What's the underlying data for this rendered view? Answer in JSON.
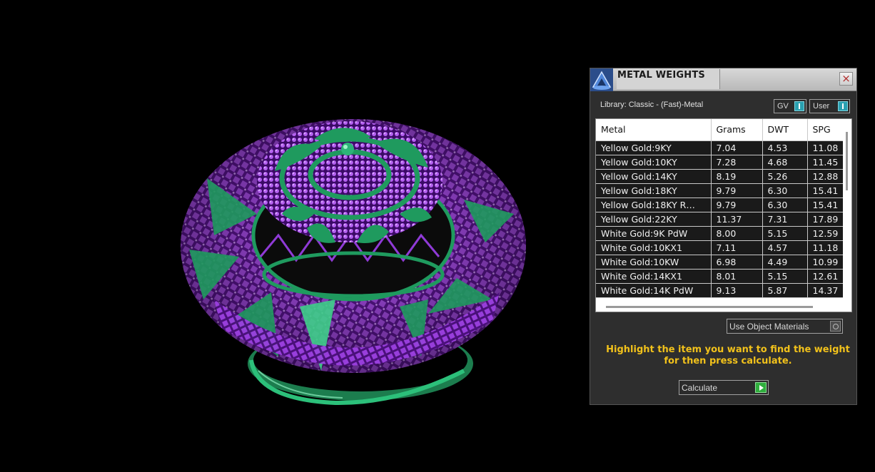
{
  "panel": {
    "title": "METAL WEIGHTS",
    "close_symbol": "×",
    "library_label": "Library: Classic - (Fast)-Metal",
    "gv_label": "GV",
    "user_label": "User",
    "use_object_materials_label": "Use Object Materials",
    "hint_line1": "Highlight the item you want to find the weight",
    "hint_line2": "for then press calculate.",
    "calculate_label": "Calculate"
  },
  "table": {
    "columns": [
      "Metal",
      "Grams",
      "DWT",
      "SPG"
    ],
    "rows": [
      [
        "Yellow Gold:9KY",
        "7.04",
        "4.53",
        "11.08"
      ],
      [
        "Yellow Gold:10KY",
        "7.28",
        "4.68",
        "11.45"
      ],
      [
        "Yellow Gold:14KY",
        "8.19",
        "5.26",
        "12.88"
      ],
      [
        "Yellow Gold:18KY",
        "9.79",
        "6.30",
        "15.41"
      ],
      [
        "Yellow Gold:18KY R…",
        "9.79",
        "6.30",
        "15.41"
      ],
      [
        "Yellow Gold:22KY",
        "11.37",
        "7.31",
        "17.89"
      ],
      [
        "White Gold:9K PdW",
        "8.00",
        "5.15",
        "12.59"
      ],
      [
        "White Gold:10KX1",
        "7.11",
        "4.57",
        "11.18"
      ],
      [
        "White Gold:10KW",
        "6.98",
        "4.49",
        "10.99"
      ],
      [
        "White Gold:14KX1",
        "8.01",
        "5.15",
        "12.61"
      ],
      [
        "White Gold:14K PdW",
        "9.13",
        "5.87",
        "14.37"
      ]
    ]
  },
  "colors": {
    "hint_text": "#f2c21b",
    "ring_purple": "#8a2bd0",
    "ring_green": "#1f9a5e"
  },
  "icons": {
    "app": "rhino-jewel-icon",
    "close": "close-icon",
    "gv_toggle": "toggle-icon",
    "user_toggle": "toggle-icon",
    "materials": "radio-icon",
    "calculate": "play-icon"
  }
}
